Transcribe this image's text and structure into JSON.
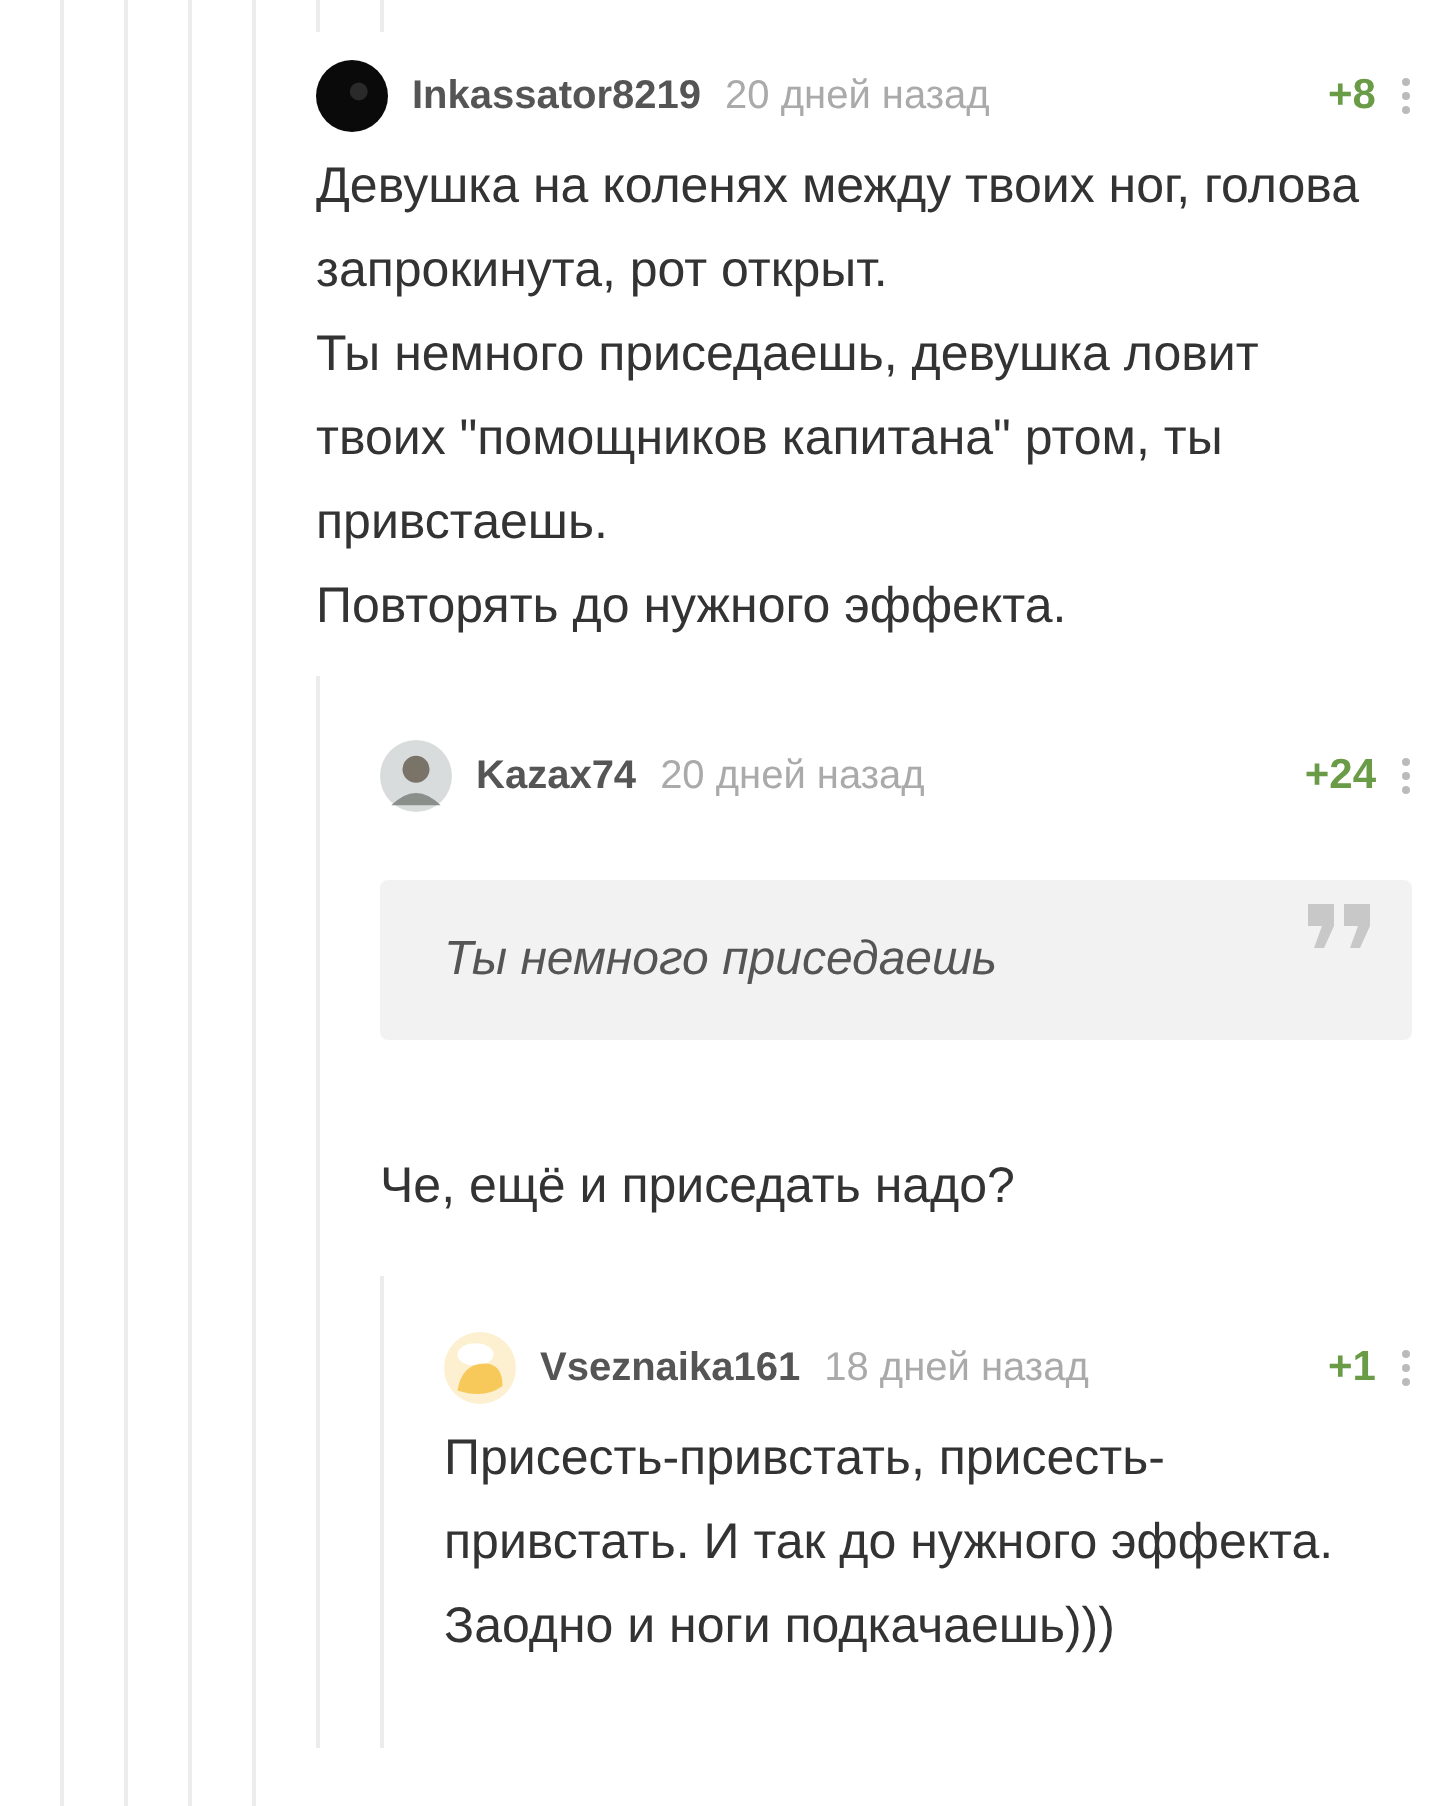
{
  "comments": [
    {
      "author": "Inkassator8219",
      "time": "20 дней назад",
      "rating": "+8",
      "avatar": {
        "kind": "dark"
      },
      "paragraphs": [
        "Девушка на коленях между твоих ног, голова запрокинута, рот открыт.",
        "Ты немного приседаешь, девушка ловит твоих \"помощников капитана\" ртом, ты привстаешь.",
        "Повторять до нужного эффекта."
      ],
      "children": [
        {
          "author": "Kazax74",
          "time": "20 дней назад",
          "rating": "+24",
          "avatar": {
            "kind": "gray"
          },
          "quote": "Ты немного приседаешь",
          "paragraphs": [
            "Че, ещё и приседать надо?"
          ],
          "children": [
            {
              "author": "Vseznaika161",
              "time": "18 дней назад",
              "rating": "+1",
              "avatar": {
                "kind": "light"
              },
              "paragraphs": [
                "Присесть-привстать, присесть-привстать. И так до нужного эффекта. Заодно и ноги подкачаешь)))"
              ]
            }
          ]
        }
      ]
    }
  ]
}
